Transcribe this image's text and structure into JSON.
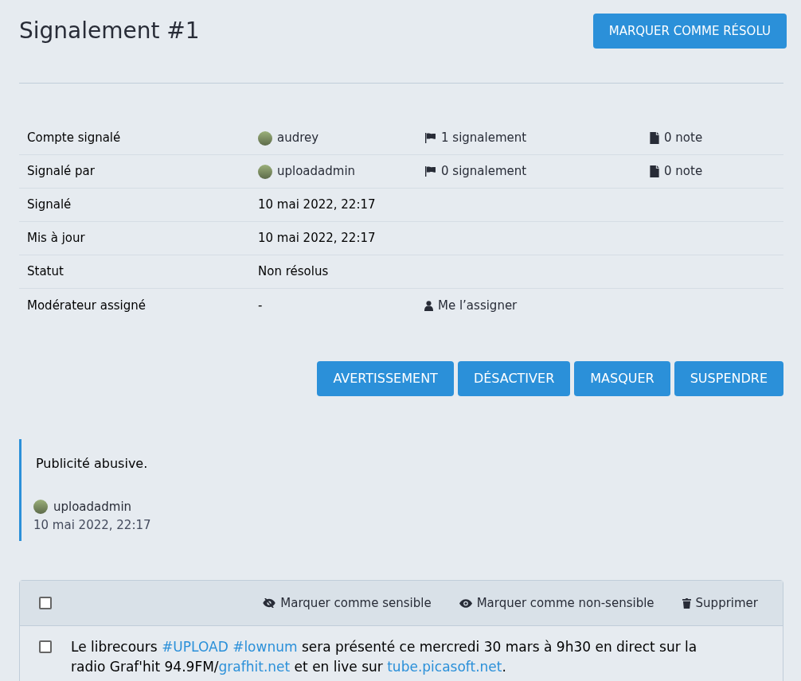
{
  "title": "Signalement #1",
  "resolve_button": "MARQUER COMME RÉSOLU",
  "details": [
    {
      "label": "Compte signalé",
      "value": "audrey",
      "kind": "account",
      "reports": "1 signalement",
      "notes": "0 note"
    },
    {
      "label": "Signalé par",
      "value": "uploadadmin",
      "kind": "account",
      "reports": "0 signalement",
      "notes": "0 note"
    },
    {
      "label": "Signalé",
      "value": "10 mai 2022, 22:17",
      "kind": "text"
    },
    {
      "label": "Mis à jour",
      "value": "10 mai 2022, 22:17",
      "kind": "text"
    },
    {
      "label": "Statut",
      "value": "Non résolus",
      "kind": "text"
    },
    {
      "label": "Modérateur assigné",
      "value": "-",
      "kind": "assign",
      "action": "Me l’assigner"
    }
  ],
  "actions": [
    "AVERTISSEMENT",
    "DÉSACTIVER",
    "MASQUER",
    "SUSPENDRE"
  ],
  "comment": {
    "text": "Publicité abusive.",
    "author": "uploadadmin",
    "date": "10 mai 2022, 22:17"
  },
  "batch": {
    "select_all_checked": false,
    "actions": [
      {
        "label": "Marquer comme sensible",
        "kind": "eye-slash"
      },
      {
        "label": "Marquer comme non-sensible",
        "kind": "eye"
      },
      {
        "label": "Supprimer",
        "kind": "trash"
      }
    ],
    "statuses": [
      {
        "checked": false,
        "content": [
          {
            "kind": "text",
            "text": "Le librecours "
          },
          {
            "kind": "link",
            "text": "#UPLOAD"
          },
          {
            "kind": "link",
            "text": "#lownum",
            "space_before": true
          },
          {
            "kind": "text",
            "text": " sera présenté ce mercredi 30 mars à 9h30 en direct sur la radio Graf'hit 94.9FM/"
          },
          {
            "kind": "link",
            "text": "grafhit.net"
          },
          {
            "kind": "text",
            "text": " et en live sur "
          },
          {
            "kind": "link",
            "text": "tube.picasoft.net"
          },
          {
            "kind": "text",
            "text": "."
          }
        ]
      }
    ]
  }
}
